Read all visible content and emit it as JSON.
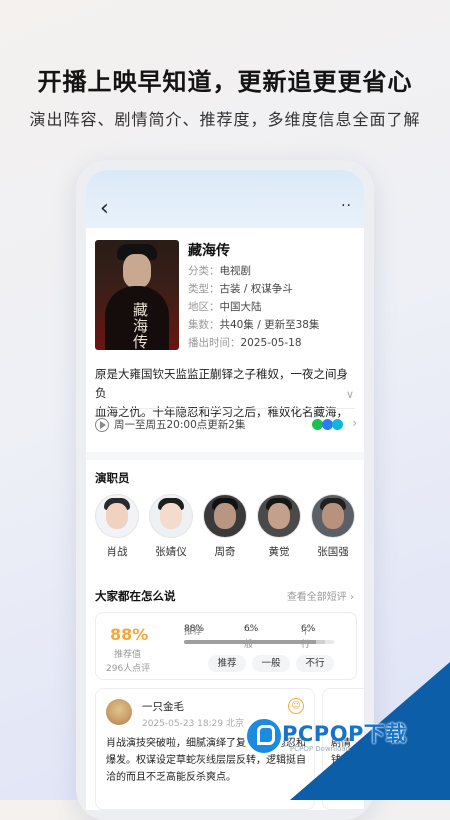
{
  "headline": "开播上映早知道，更新追更更省心",
  "subline": "演出阵容、剧情简介、推荐度，多维度信息全面了解",
  "header": {
    "back_icon": "chevron-left-icon",
    "more_icon": "more-dots-icon",
    "more_text": "··"
  },
  "drama": {
    "title": "藏海传",
    "poster_title": "藏海传",
    "category_label": "分类：",
    "category": "电视剧",
    "type_label": "类型：",
    "type": "古装 / 权谋争斗",
    "region_label": "地区：",
    "region": "中国大陆",
    "episodes_label": "集数：",
    "episodes": "共40集 / 更新至38集",
    "airdate_label": "播出时间：",
    "airdate": "2025-05-18",
    "synopsis_line1": "原是大雍国钦天监监正蒯铎之子稚奴，一夜之间身负",
    "synopsis_line2": "血海之仇。十年隐忍和学习之后，稚奴化名藏海，",
    "expand_icon": "∨",
    "schedule": "周一至周五20:00点更新2集",
    "platform_colors": [
      "#18c24c",
      "#2a7cf6",
      "#12b5d6"
    ]
  },
  "cast": {
    "title": "演职员",
    "members": [
      {
        "name": "肖战"
      },
      {
        "name": "张婧仪"
      },
      {
        "name": "周奇"
      },
      {
        "name": "黄觉"
      },
      {
        "name": "张国强"
      }
    ]
  },
  "reviews": {
    "title": "大家都在怎么说",
    "see_all": "查看全部短评 ›",
    "percent": "88%",
    "percent_label": "推荐值",
    "count": "296人点评",
    "recommend_label": "推荐",
    "recommend_pct": "88%",
    "neutral_label": "一般",
    "neutral_pct": "6%",
    "not_recommend_label": "不行",
    "not_recommend_pct": "6%",
    "recommend_fraction": 0.88,
    "neutral_fraction": 0.06,
    "vote_recommend": "推荐",
    "vote_neutral": "一般",
    "vote_bad": "不行",
    "comment": {
      "user": "一只金毛",
      "time": "2025-05-23 18:29  北京",
      "text": "肖战演技突破啦，细腻演绎了复仇者的隐忍和爆发。权谋设定草蛇灰线层层反转，逻辑挺自洽的而且不乏高能反杀爽点。"
    },
    "comment2": {
      "line1": "剧情",
      "line2": "钱密码",
      "line3": "权谋外"
    }
  },
  "watermark": {
    "text": "PCPOP下载",
    "small": "PCPOP Download"
  }
}
